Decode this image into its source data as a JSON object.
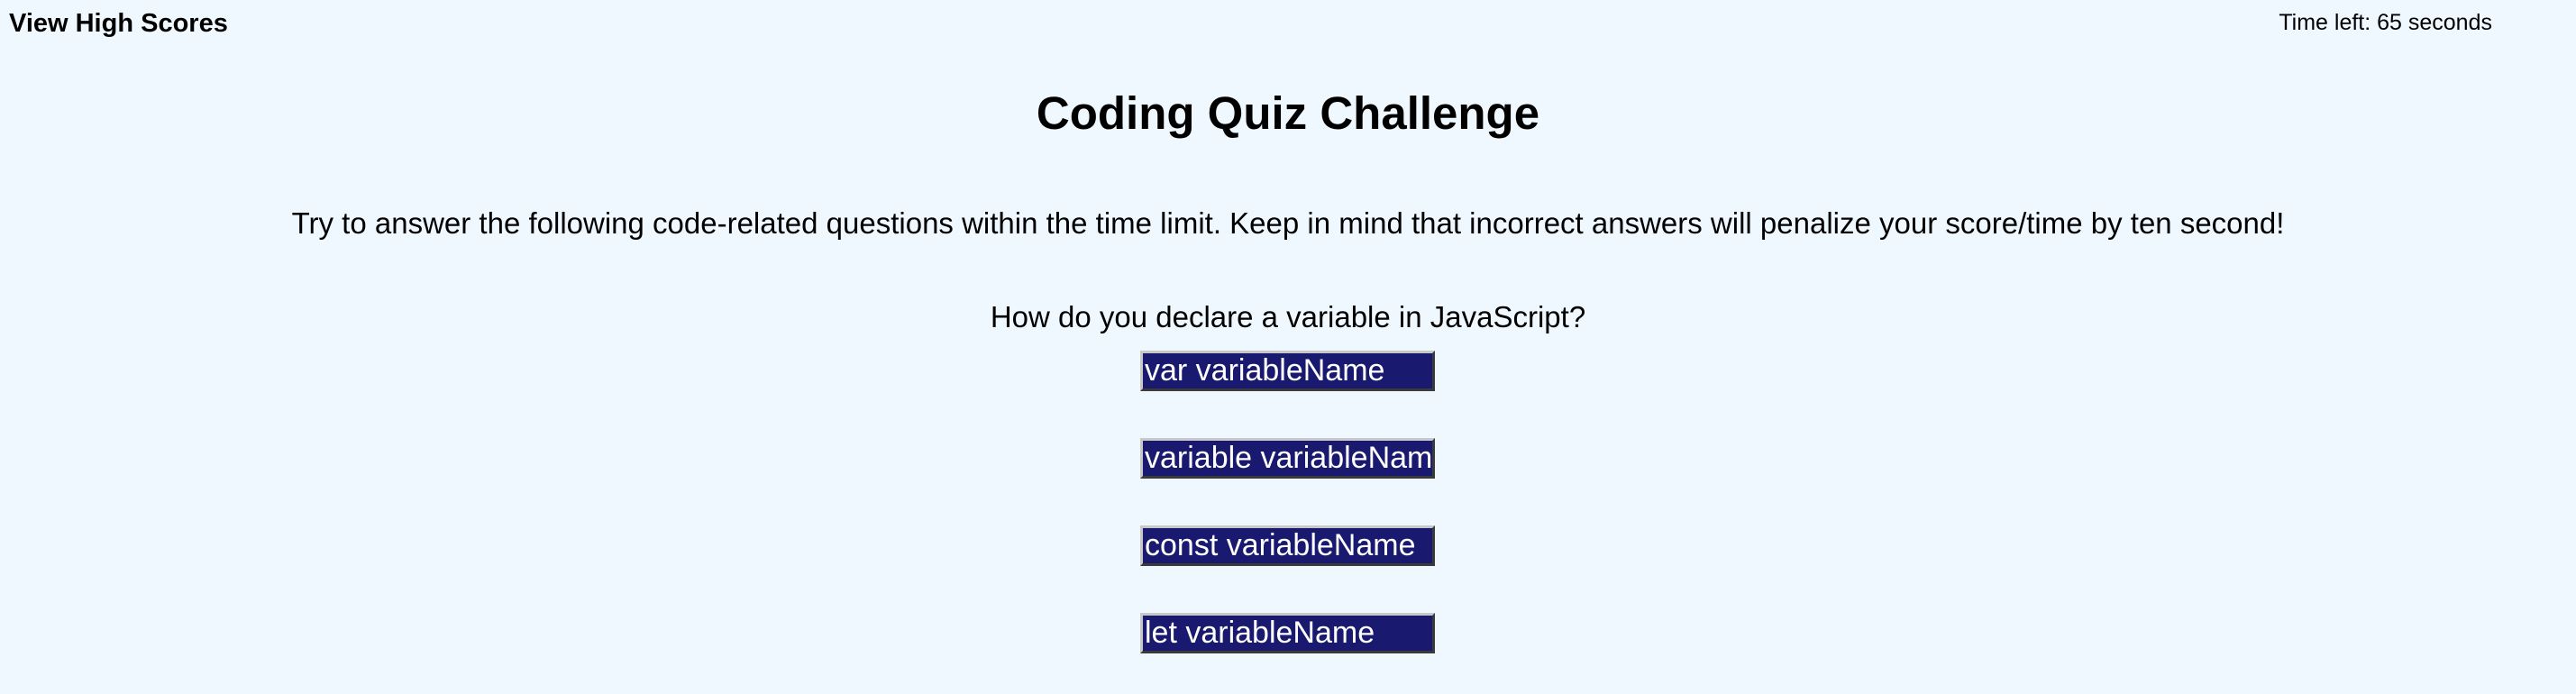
{
  "header": {
    "high_scores_label": "View High Scores",
    "timer_text": "Time left: 65 seconds"
  },
  "quiz": {
    "title": "Coding Quiz Challenge",
    "intro": "Try to answer the following code-related questions within the time limit. Keep in mind that incorrect answers will penalize your score/time by ten second!",
    "question": "How do you declare a variable in JavaScript?",
    "answers": [
      "var variableName",
      "variable variableName",
      "const variableName",
      "let variableName"
    ]
  },
  "colors": {
    "background": "#f0f8ff",
    "answer_button_bg": "#191970",
    "answer_button_text": "#ffffff"
  }
}
